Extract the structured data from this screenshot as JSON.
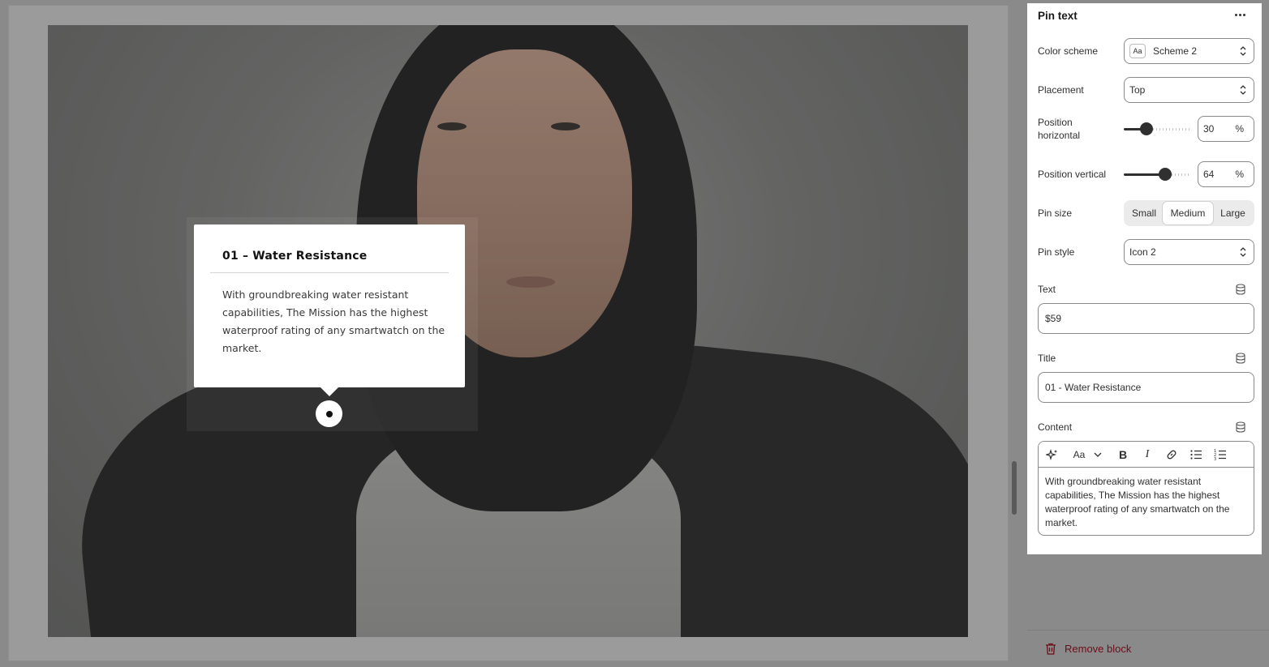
{
  "preview": {
    "tooltip": {
      "title": "01 – Water Resistance",
      "body": "With groundbreaking water resistant capabilities, The Mission has the highest waterproof rating of any smartwatch on the market."
    }
  },
  "panel": {
    "title": "Pin text",
    "color_scheme": {
      "label": "Color scheme",
      "badge": "Aa",
      "value": "Scheme 2"
    },
    "placement": {
      "label": "Placement",
      "value": "Top"
    },
    "position_horizontal": {
      "label_line1": "Position",
      "label_line2": "horizontal",
      "value": "30",
      "unit": "%",
      "fraction": 0.3
    },
    "position_vertical": {
      "label": "Position vertical",
      "value": "64",
      "unit": "%",
      "fraction": 0.64
    },
    "pin_size": {
      "label": "Pin size",
      "options": [
        "Small",
        "Medium",
        "Large"
      ],
      "selected": "Medium"
    },
    "pin_style": {
      "label": "Pin style",
      "value": "Icon 2"
    },
    "text": {
      "label": "Text",
      "value": "$59"
    },
    "title_field": {
      "label": "Title",
      "value": "01 - Water Resistance"
    },
    "content": {
      "label": "Content",
      "toolbar": {
        "font_label": "Aa"
      },
      "value": "With groundbreaking water resistant capabilities, The Mission has the highest waterproof rating of any smartwatch on the market."
    }
  },
  "footer": {
    "remove_label": "Remove block"
  },
  "colors": {
    "accent_danger": "#6b0e1b",
    "panel_bg": "#ffffff",
    "overlay": "#8a8a8a"
  }
}
